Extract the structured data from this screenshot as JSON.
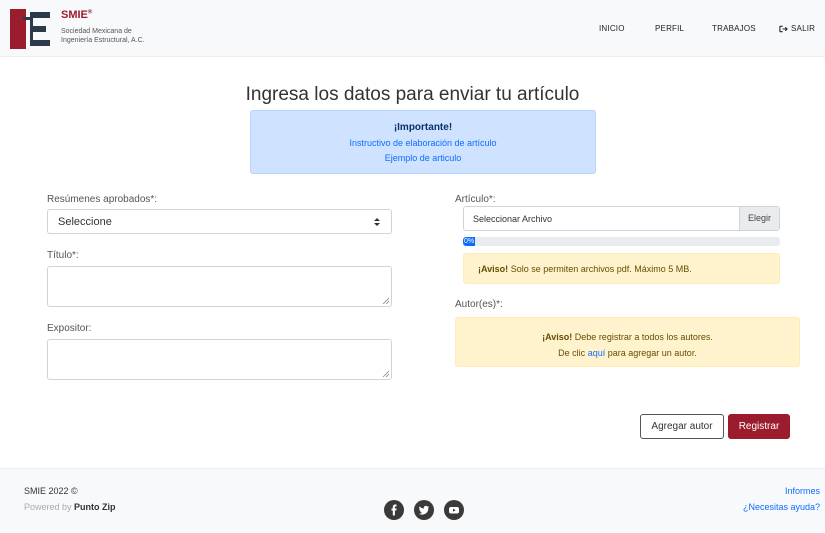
{
  "brand": {
    "name": "SMIE",
    "trademark": "®",
    "subtitle_line1": "Sociedad Mexicana de",
    "subtitle_line2": "Ingeniería Estructural, A.C."
  },
  "nav": {
    "items": [
      "INICIO",
      "PERFIL",
      "TRABAJOS"
    ],
    "logout": "SALIR"
  },
  "page": {
    "title": "Ingresa los datos para enviar tu artículo"
  },
  "info": {
    "heading": "¡Importante!",
    "link1": "Instructivo de elaboración de artículo",
    "link2": "Ejemplo de articulo"
  },
  "form": {
    "resumenes_label": "Resúmenes aprobados*:",
    "resumenes_value": "Seleccione",
    "titulo_label": "Título*:",
    "expositor_label": "Expositor:",
    "articulo_label": "Artículo*:",
    "file_placeholder": "Seleccionar Archivo",
    "file_button": "Elegir",
    "progress_label": "0%",
    "progress_value": 0,
    "file_warning_strong": "¡Aviso!",
    "file_warning_text": "Solo se permiten archivos pdf. Máximo 5 MB.",
    "autores_label": "Autor(es)*:",
    "author_warning_strong": "¡Aviso!",
    "author_warning_text": "Debe registrar a todos los autores.",
    "author_line2_pre": "De clic",
    "author_line2_link": "aquí",
    "author_line2_post": "para agregar un autor.",
    "add_author_button": "Agregar autor",
    "submit_button": "Registrar"
  },
  "footer": {
    "copyright": "SMIE 2022 ©",
    "powered_prefix": "Powered by",
    "powered_by": "Punto Zip",
    "social": [
      "facebook-icon",
      "twitter-icon",
      "youtube-icon"
    ],
    "link_reports": "Informes",
    "link_help": "¿Necesitas ayuda?"
  },
  "colors": {
    "brand": "#9b1c2c",
    "info_bg": "#cfe2ff",
    "warning_bg": "#fff3cd",
    "link": "#0d6efd"
  }
}
